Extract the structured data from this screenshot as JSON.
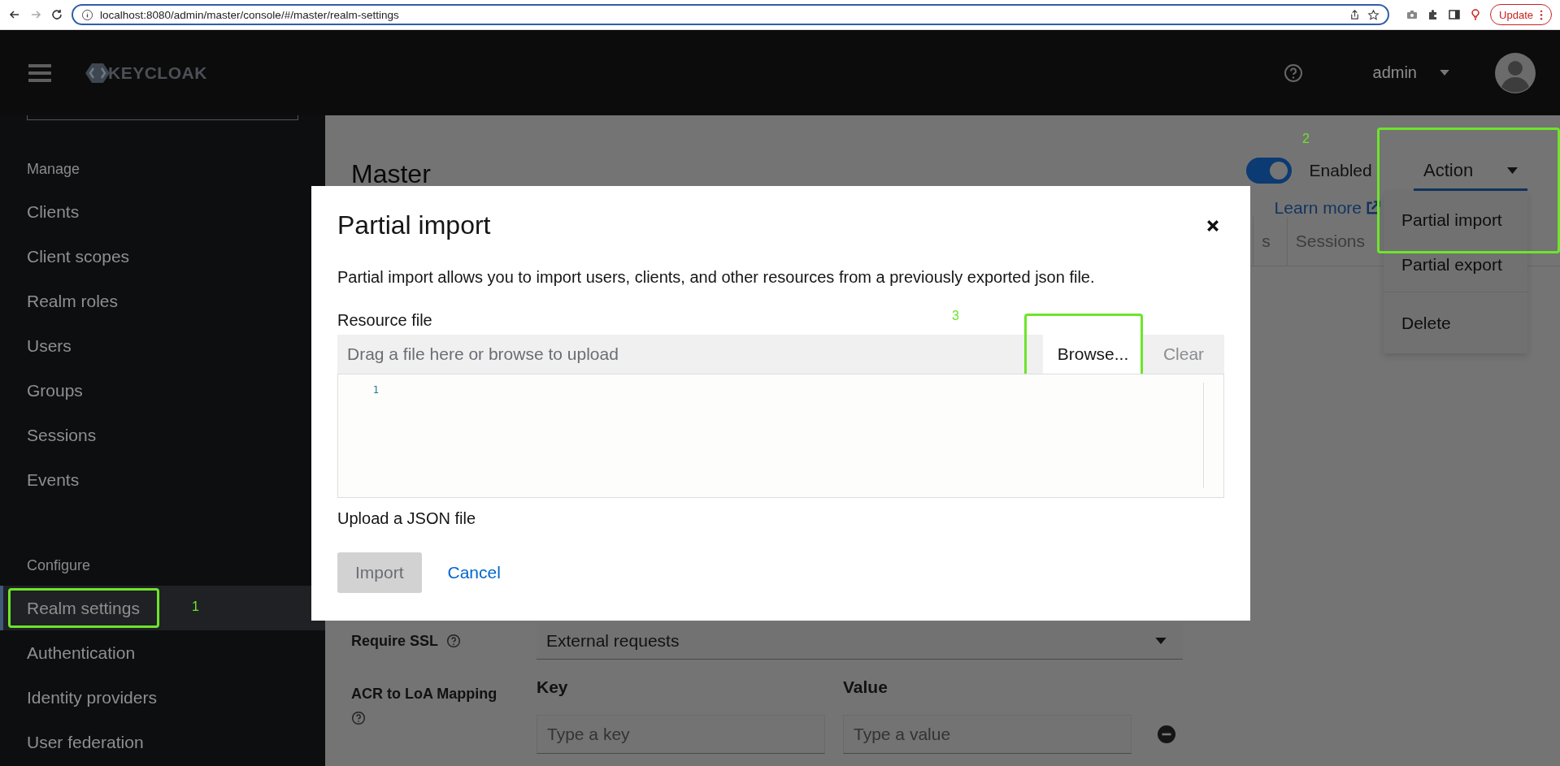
{
  "browser": {
    "url": "localhost:8080/admin/master/console/#/master/realm-settings",
    "update_button": "Update"
  },
  "header": {
    "logo": "KEYCLOAK",
    "user": "admin"
  },
  "sidebar": {
    "sections": [
      {
        "heading": "Manage",
        "items": [
          {
            "label": "Clients",
            "selected": false
          },
          {
            "label": "Client scopes",
            "selected": false
          },
          {
            "label": "Realm roles",
            "selected": false
          },
          {
            "label": "Users",
            "selected": false
          },
          {
            "label": "Groups",
            "selected": false
          },
          {
            "label": "Sessions",
            "selected": false
          },
          {
            "label": "Events",
            "selected": false
          }
        ]
      },
      {
        "heading": "Configure",
        "items": [
          {
            "label": "Realm settings",
            "selected": true,
            "annotation": "1"
          },
          {
            "label": "Authentication",
            "selected": false
          },
          {
            "label": "Identity providers",
            "selected": false
          },
          {
            "label": "User federation",
            "selected": false
          }
        ]
      }
    ]
  },
  "page": {
    "title": "Master",
    "enabled": true,
    "enabled_label": "Enabled",
    "learn_more": "Learn more",
    "action": "Action",
    "action_menu": [
      {
        "label": "Partial import",
        "annotation": "2"
      },
      {
        "label": "Partial export"
      },
      {
        "label": "Delete"
      }
    ],
    "tabs": [
      {
        "label": "s"
      },
      {
        "label": "Sessions"
      }
    ],
    "require_ssl": {
      "label": "Require SSL",
      "value": "External requests"
    },
    "acr": {
      "label": "ACR to LoA Mapping",
      "key_heading": "Key",
      "value_heading": "Value",
      "key_placeholder": "Type a key",
      "value_placeholder": "Type a value"
    }
  },
  "modal": {
    "title": "Partial import",
    "description": "Partial import allows you to import users, clients, and other resources from a previously exported json file.",
    "field_label": "Resource file",
    "placeholder": "Drag a file here or browse to upload",
    "browse": "Browse...",
    "browse_annotation": "3",
    "clear": "Clear",
    "line_numbers": [
      "1"
    ],
    "helper": "Upload a JSON file",
    "buttons": [
      {
        "label": "Import",
        "kind": "primary",
        "disabled": true
      },
      {
        "label": "Cancel",
        "kind": "link",
        "disabled": false
      }
    ]
  }
}
